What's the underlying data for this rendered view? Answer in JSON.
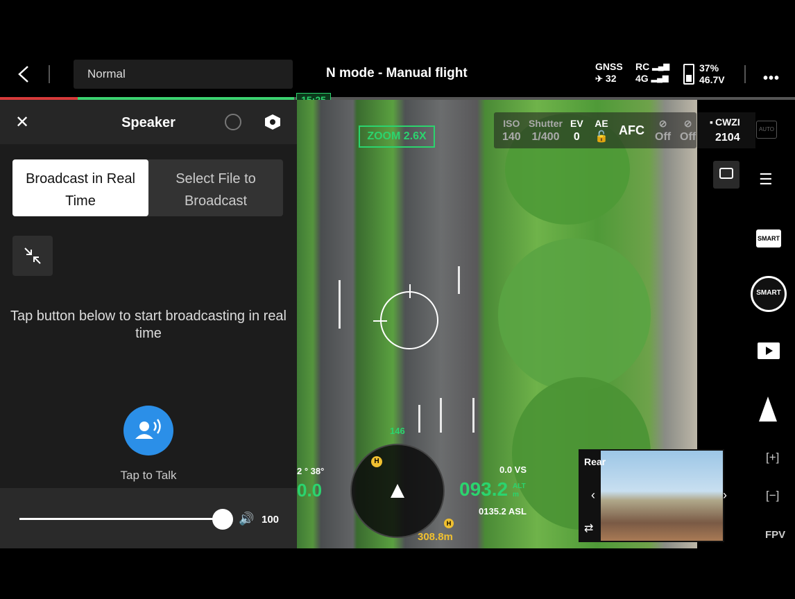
{
  "topbar": {
    "flight_mode_select": "Normal",
    "title": "N mode - Manual flight",
    "gnss_label": "GNSS",
    "gnss_count": "32",
    "rc_label": "RC",
    "net_label": "4G",
    "battery_pct": "37%",
    "battery_voltage": "46.7V",
    "time": "15:25",
    "flight_progress_pct": 37
  },
  "speaker": {
    "title": "Speaker",
    "tab_realtime": "Broadcast in Real Time",
    "tab_file": "Select File to Broadcast",
    "hint": "Tap button below to start broadcasting in real time",
    "talk_label": "Tap to Talk",
    "volume": "100",
    "volume_fraction": 1.0
  },
  "camera": {
    "iso_label": "ISO",
    "iso_value": "140",
    "shutter_label": "Shutter",
    "shutter_value": "1/400",
    "ev_label": "EV",
    "ev_value": "0",
    "ae_label": "AE",
    "focus_mode": "AFC",
    "opt1_value": "Off",
    "opt2_value": "Off",
    "storage_label": "CWZI",
    "storage_count": "2104",
    "auto_badge": "AUTO",
    "zoom_label": "ZOOM 2.6X"
  },
  "rail": {
    "smart_label": "SMART",
    "shutter_label": "SMART",
    "plus_label": "[+]",
    "minus_label": "[−]",
    "fpv_label": "FPV"
  },
  "hud": {
    "heading": "146",
    "vs": "0.0 VS",
    "alt": "093.2",
    "alt_label": "ALT",
    "alt_unit": "m",
    "asl": "0135.2 ASL",
    "home_distance": "308.8m",
    "speed": "0.0",
    "attitude": "2 ° 38°",
    "rear_label": "Rear"
  },
  "colors": {
    "accent_green": "#2bd46e",
    "talk_blue": "#2b8fe8",
    "home_yellow": "#f0c030"
  }
}
